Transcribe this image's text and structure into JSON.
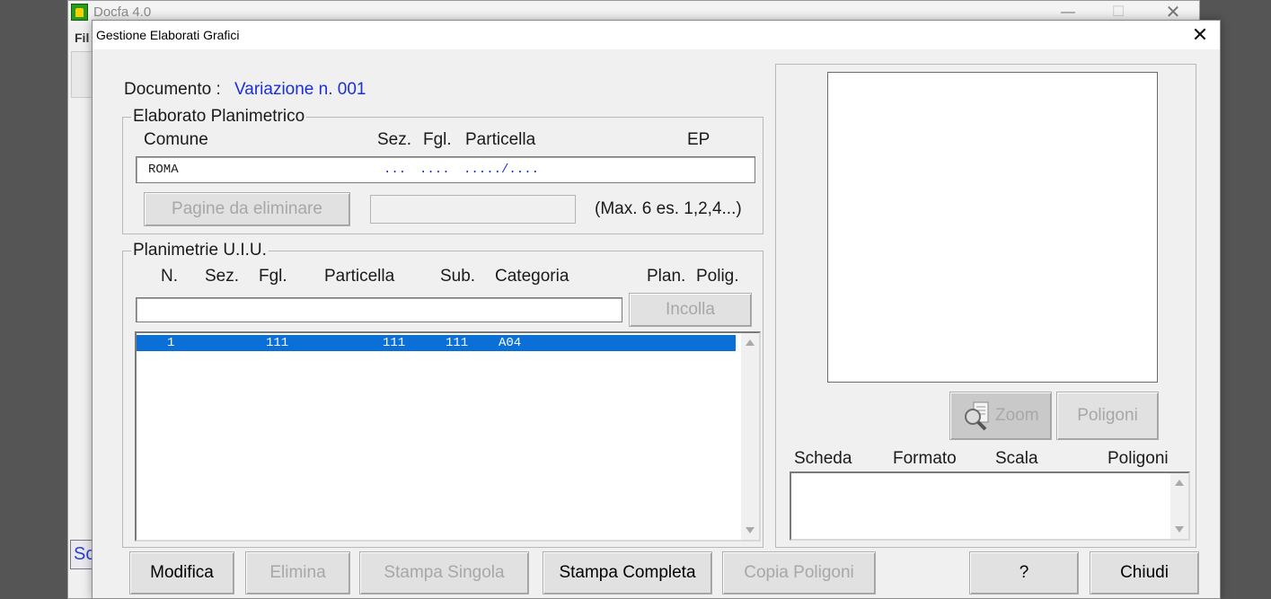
{
  "parent_window": {
    "title": "Docfa 4.0",
    "menu_file": "Fil",
    "status_text": "Sc"
  },
  "dialog": {
    "title": "Gestione Elaborati Grafici"
  },
  "documento": {
    "label": "Documento :",
    "value": "Variazione n. 001"
  },
  "elaborato_planimetrico": {
    "legend": "Elaborato Planimetrico",
    "headers": {
      "comune": "Comune",
      "sez": "Sez.",
      "fgl": "Fgl.",
      "particella": "Particella",
      "ep": "EP"
    },
    "row": {
      "comune": "ROMA",
      "sez": "...",
      "fgl": "....",
      "particella": "...../...."
    },
    "pagine_button": "Pagine da eliminare",
    "pagine_value": "",
    "hint": "(Max. 6  es. 1,2,4...)"
  },
  "planimetrie": {
    "legend": "Planimetrie U.I.U.",
    "headers": {
      "n": "N.",
      "sez": "Sez.",
      "fgl": "Fgl.",
      "particella": "Particella",
      "sub": "Sub.",
      "categoria": "Categoria",
      "plan": "Plan.",
      "polig": "Polig."
    },
    "input_value": "",
    "incolla_button": "Incolla",
    "rows": [
      {
        "n": "1",
        "fgl": "111",
        "particella": "111",
        "sub": "111",
        "categoria": "A04",
        "selected": true
      }
    ]
  },
  "preview_panel": {
    "zoom_button": "Zoom",
    "poligoni_button": "Poligoni",
    "headers": {
      "scheda": "Scheda",
      "formato": "Formato",
      "scala": "Scala",
      "poligoni": "Poligoni"
    }
  },
  "bottom_buttons": {
    "modifica": "Modifica",
    "elimina": "Elimina",
    "stampa_singola": "Stampa Singola",
    "stampa_completa": "Stampa Completa",
    "copia_poligoni": "Copia Poligoni",
    "help": "?",
    "chiudi": "Chiudi"
  },
  "colors": {
    "selection": "#0a6fd6",
    "value_blue": "#1a2fd8",
    "disabled_text": "#a7a7a7"
  }
}
